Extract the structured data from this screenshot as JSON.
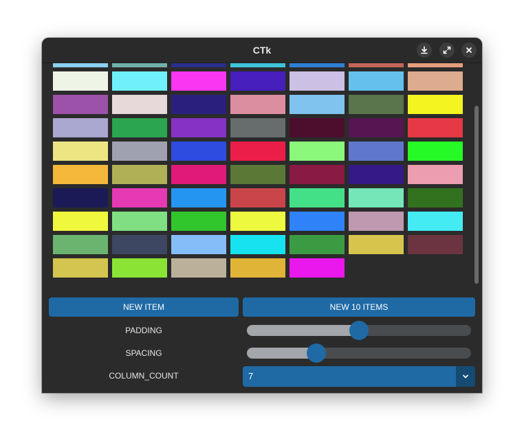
{
  "window": {
    "title": "CTk",
    "icons": [
      "download-icon",
      "maximize-icon",
      "close-icon"
    ]
  },
  "grid": {
    "columns": 7,
    "swatches": [
      "#8ad1f1",
      "#72b0a9",
      "#2a2f8c",
      "#3fc4d9",
      "#2f7fd5",
      "#c36659",
      "#e59d7c",
      "#eef5e6",
      "#70f0fb",
      "#fa36f3",
      "#471fbc",
      "#ccc0e4",
      "#64c1ee",
      "#ddab8d",
      "#9c52a8",
      "#e7d9d9",
      "#2a1f7d",
      "#dc8ea1",
      "#7fc3ee",
      "#5a744c",
      "#f4f421",
      "#aaa7d1",
      "#2ba550",
      "#8633c3",
      "#676c6c",
      "#4d0e2e",
      "#571551",
      "#e53945",
      "#ece582",
      "#9fa1b1",
      "#2f4ce0",
      "#eb1e4a",
      "#8bf77b",
      "#5f77cc",
      "#26fa26",
      "#f4b83a",
      "#b0b057",
      "#e01a78",
      "#5b7836",
      "#881a43",
      "#341a87",
      "#ec9db0",
      "#1b1a57",
      "#e53ab4",
      "#2595f2",
      "#ca454a",
      "#44e088",
      "#74e6b8",
      "#32721e",
      "#f0f83e",
      "#81df83",
      "#31c62c",
      "#ecf93f",
      "#2f82f8",
      "#be99b0",
      "#44ebf3",
      "#6bb46f",
      "#3e4762",
      "#84bdf7",
      "#17e2f0",
      "#3b9b43",
      "#d6c44c",
      "#6b3440",
      "#d3c550",
      "#8be336",
      "#bbb19a",
      "#e0b537",
      "#ea18ec"
    ]
  },
  "controls": {
    "new_item_label": "NEW ITEM",
    "new_10_items_label": "NEW 10 ITEMS",
    "padding_label": "PADDING",
    "padding_value": 0.5,
    "spacing_label": "SPACING",
    "spacing_value": 0.3,
    "column_count_label": "COLUMN_COUNT",
    "column_count_value": "7"
  },
  "colors": {
    "accent": "#1f6aa5",
    "background": "#2b2b2b"
  }
}
